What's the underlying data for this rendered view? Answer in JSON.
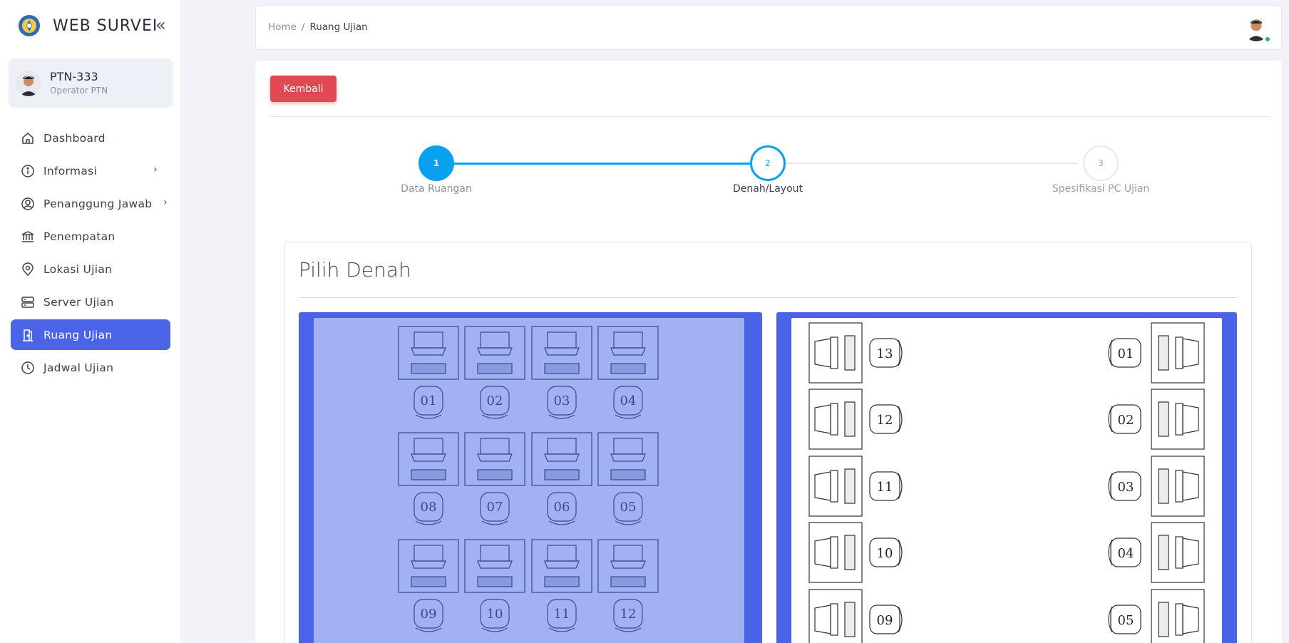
{
  "app": {
    "title": "WEB SURVEI"
  },
  "user": {
    "name": "PTN-333",
    "role": "Operator PTN"
  },
  "nav": {
    "items": [
      {
        "label": "Dashboard",
        "icon": "home-icon"
      },
      {
        "label": "Informasi",
        "icon": "info-icon",
        "has_children": true
      },
      {
        "label": "Penanggung Jawab",
        "icon": "user-circle-icon",
        "has_children": true
      },
      {
        "label": "Penempatan",
        "icon": "bank-icon"
      },
      {
        "label": "Lokasi Ujian",
        "icon": "map-pin-icon"
      },
      {
        "label": "Server Ujian",
        "icon": "server-icon"
      },
      {
        "label": "Ruang Ujian",
        "icon": "door-icon",
        "active": true
      },
      {
        "label": "Jadwal Ujian",
        "icon": "clock-icon"
      }
    ]
  },
  "breadcrumb": {
    "home": "Home",
    "separator": "/",
    "current": "Ruang Ujian"
  },
  "actions": {
    "back_label": "Kembali"
  },
  "stepper": {
    "steps": [
      {
        "number": "1",
        "label": "Data Ruangan",
        "state": "done"
      },
      {
        "number": "2",
        "label": "Denah/Layout",
        "state": "active"
      },
      {
        "number": "3",
        "label": "Spesifikasi PC Ujian",
        "state": "pending"
      }
    ]
  },
  "card": {
    "title": "Pilih Denah"
  },
  "layouts": [
    {
      "id": "layout-grid",
      "selected": true,
      "rows": [
        [
          "01",
          "02",
          "03",
          "04"
        ],
        [
          "08",
          "07",
          "06",
          "05"
        ],
        [
          "09",
          "10",
          "11",
          "12"
        ]
      ]
    },
    {
      "id": "layout-sides",
      "selected": false,
      "left_column": [
        "13",
        "12",
        "11",
        "10",
        "09"
      ],
      "right_column": [
        "01",
        "02",
        "03",
        "04",
        "05"
      ]
    }
  ],
  "colors": {
    "primary": "#4a63e7",
    "primary_light": "#a2b1f1",
    "danger": "#e04852",
    "step_blue": "#0aa0f0",
    "step_grey": "#dfe2e8",
    "online": "#22b573"
  }
}
